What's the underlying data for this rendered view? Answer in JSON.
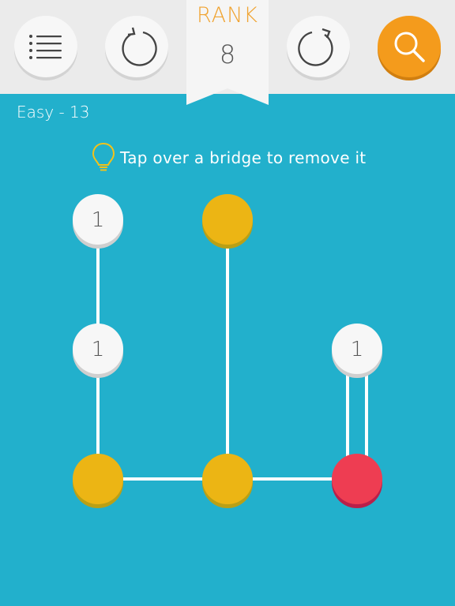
{
  "toolbar": {
    "menu_icon": "menu-list-icon",
    "undo_icon": "undo-icon",
    "restart_icon": "restart-icon",
    "hint_icon": "magnifier-icon",
    "rank_label": "RANK",
    "rank_value": "8"
  },
  "level": {
    "label": "Easy - 13"
  },
  "hint": {
    "icon": "lightbulb-icon",
    "text": "Tap over a bridge to remove it"
  },
  "colors": {
    "background": "#22b0cc",
    "topbar": "#ebebeb",
    "accent_orange": "#f49b1c",
    "node_white": "#f7f7f7",
    "node_yellow": "#ecb514",
    "node_red": "#ee3d52",
    "bridge": "#ffffff"
  },
  "board": {
    "nodes": [
      {
        "id": "n1",
        "state": "white",
        "label": "1"
      },
      {
        "id": "n2",
        "state": "yellow",
        "label": ""
      },
      {
        "id": "n3",
        "state": "white",
        "label": "1"
      },
      {
        "id": "n4",
        "state": "white",
        "label": "1"
      },
      {
        "id": "n5",
        "state": "yellow",
        "label": ""
      },
      {
        "id": "n6",
        "state": "yellow",
        "label": ""
      },
      {
        "id": "n7",
        "state": "red",
        "label": ""
      }
    ],
    "bridges": [
      {
        "from": "n1",
        "to": "n3",
        "count": 1
      },
      {
        "from": "n3",
        "to": "n5",
        "count": 1
      },
      {
        "from": "n2",
        "to": "n6",
        "count": 1
      },
      {
        "from": "n5",
        "to": "n6",
        "count": 1
      },
      {
        "from": "n6",
        "to": "n7",
        "count": 1
      },
      {
        "from": "n4",
        "to": "n7",
        "count": 2
      }
    ]
  }
}
